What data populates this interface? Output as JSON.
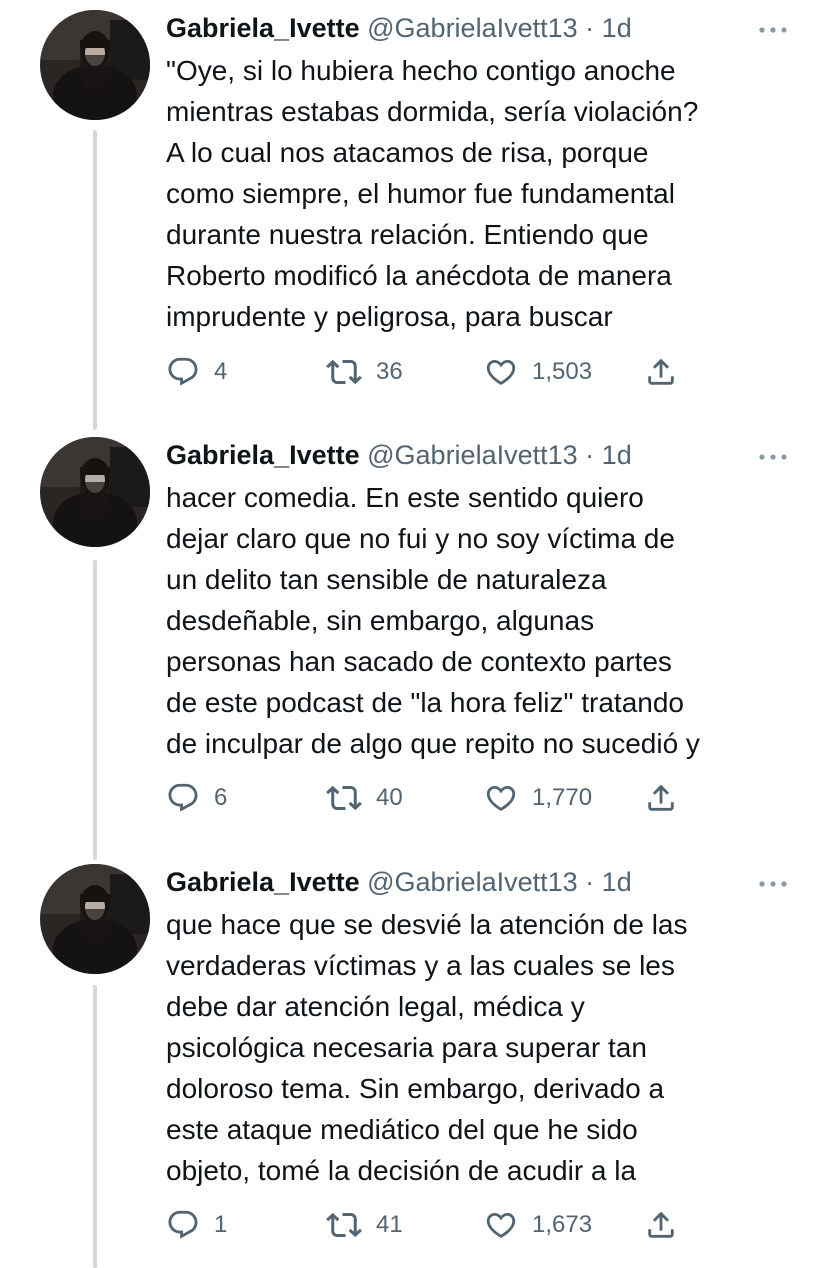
{
  "tweets": [
    {
      "author": {
        "name": "Gabriela_Ivette",
        "handle": "@GabrielaIvett13",
        "separator": "·",
        "time": "1d"
      },
      "text": "\"Oye, si lo hubiera hecho contigo anoche\nmientras estabas dormida, sería violación?\nA lo cual nos atacamos de risa, porque\ncomo siempre, el humor fue fundamental\ndurante nuestra relación. Entiendo que\nRoberto modificó la anécdota de manera\nimprudente y peligrosa, para buscar",
      "replies": "4",
      "retweets": "36",
      "likes": "1,503"
    },
    {
      "author": {
        "name": "Gabriela_Ivette",
        "handle": "@GabrielaIvett13",
        "separator": "·",
        "time": "1d"
      },
      "text": "hacer comedia. En este sentido quiero\ndejar claro que no fui y no soy víctima de\nun delito tan sensible de naturaleza\ndesdeñable, sin embargo, algunas\npersonas han sacado de contexto partes\nde este podcast de \"la hora feliz\" tratando\nde inculpar de algo que repito no sucedió y",
      "replies": "6",
      "retweets": "40",
      "likes": "1,770"
    },
    {
      "author": {
        "name": "Gabriela_Ivette",
        "handle": "@GabrielaIvett13",
        "separator": "·",
        "time": "1d"
      },
      "text": "que hace que se desvié la atención de las\nverdaderas víctimas y a las cuales se les\ndebe dar atención legal, médica y\npsicológica necesaria para superar tan\ndoloroso tema. Sin embargo, derivado a\neste ataque mediático del que he sido\nobjeto, tomé la decisión de acudir a la",
      "replies": "1",
      "retweets": "41",
      "likes": "1,673"
    }
  ],
  "icons": {
    "reply": "reply-icon",
    "retweet": "retweet-icon",
    "like": "heart-icon",
    "share": "share-icon",
    "more": "more-icon"
  },
  "colors": {
    "text": "#0f1419",
    "secondary": "#536471",
    "thread_line": "#cfd9de"
  }
}
